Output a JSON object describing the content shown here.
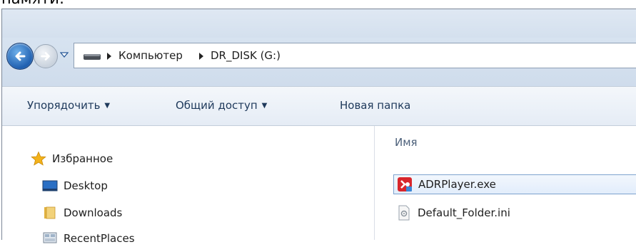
{
  "caption": {
    "text": "памяти:"
  },
  "address": {
    "crumbs": [
      "Компьютер",
      "DR_DISK (G:)"
    ]
  },
  "toolbar": {
    "organize_label": "Упорядочить",
    "share_label": "Общий доступ",
    "new_folder_label": "Новая папка"
  },
  "nav_pane": {
    "favorites_label": "Избранное",
    "items": [
      {
        "label": "Desktop",
        "icon": "desktop-icon"
      },
      {
        "label": "Downloads",
        "icon": "folder-icon"
      },
      {
        "label": "RecentPlaces",
        "icon": "recent-places-icon"
      }
    ]
  },
  "content": {
    "column_name": "Имя",
    "files": [
      {
        "name": "ADRPlayer.exe",
        "icon": "exe-app-icon",
        "selected": true
      },
      {
        "name": "Default_Folder.ini",
        "icon": "ini-file-icon",
        "selected": false
      }
    ]
  },
  "colors": {
    "accent": "#1f5fb0",
    "toolbar_text": "#1e395b",
    "selection_border": "#7da2ce"
  }
}
